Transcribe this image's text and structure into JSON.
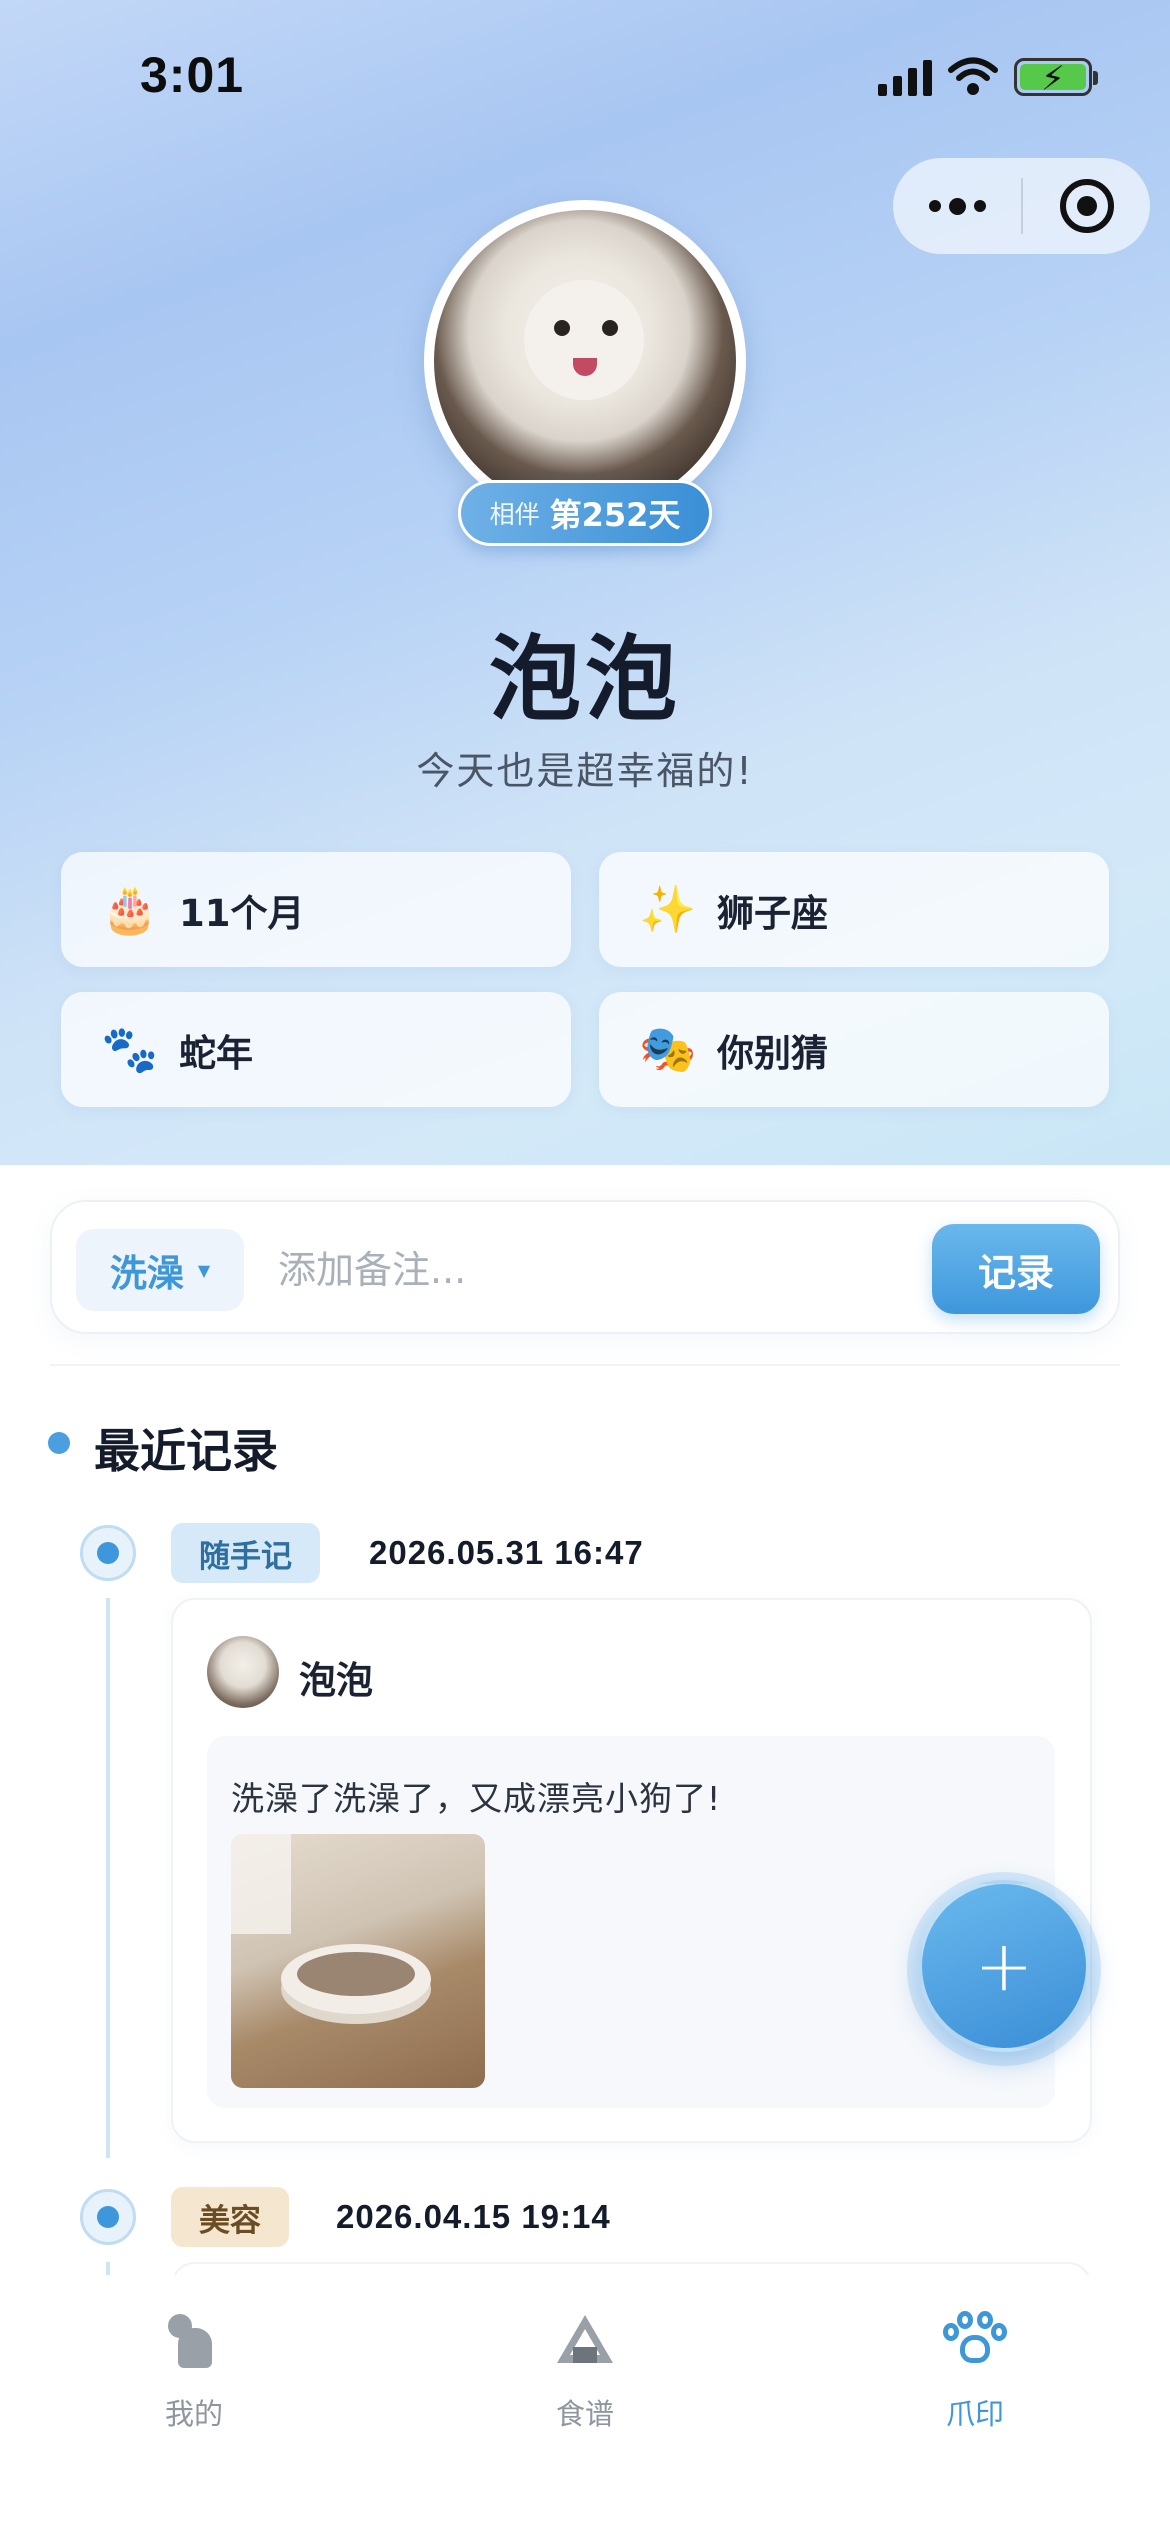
{
  "status_bar": {
    "time": "3:01"
  },
  "profile": {
    "companion_prefix": "相伴",
    "companion_days": "第252天",
    "name": "泡泡",
    "motto": "今天也是超幸福的!"
  },
  "info_cards": [
    {
      "icon": "birthday-cake-icon",
      "glyph": "🎂",
      "text": "11个月"
    },
    {
      "icon": "sparkles-icon",
      "glyph": "✨",
      "text": "狮子座"
    },
    {
      "icon": "paw-prints-icon",
      "glyph": "🐾",
      "text": "蛇年"
    },
    {
      "icon": "theater-masks-icon",
      "glyph": "🎭",
      "text": "你别猜"
    }
  ],
  "record_bar": {
    "type_value": "洗澡",
    "note_placeholder": "添加备注...",
    "submit_label": "记录"
  },
  "recent": {
    "title": "最近记录",
    "entries": [
      {
        "tag": "随手记",
        "time": "2026.05.31 16:47",
        "author": "泡泡",
        "note": "洗澡了洗澡了，又成漂亮小狗了!"
      },
      {
        "tag": "美容",
        "time": "2026.04.15 19:14"
      }
    ]
  },
  "fab": {
    "label": "+"
  },
  "tabbar": {
    "items": [
      {
        "label": "我的",
        "icon": "dog-icon"
      },
      {
        "label": "食谱",
        "icon": "onigiri-icon"
      },
      {
        "label": "爪印",
        "icon": "paw-icon",
        "active": true
      }
    ]
  },
  "colors": {
    "accent": "#3f97d8",
    "tag_note_bg": "#d6e9f8",
    "tag_grooming_bg": "#f5e6cf",
    "battery": "#56c94b"
  }
}
